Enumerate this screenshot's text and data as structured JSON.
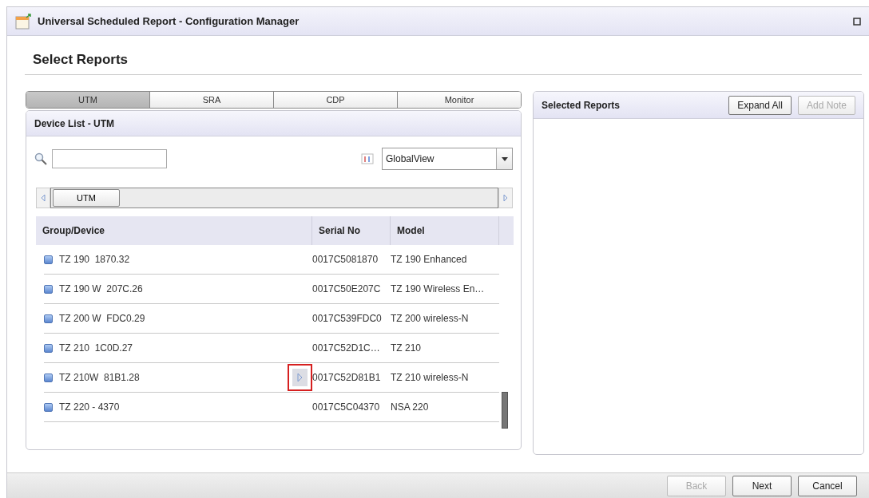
{
  "window": {
    "title": "Universal Scheduled Report - Configuration Manager"
  },
  "page_title": "Select Reports",
  "tabs": [
    {
      "label": "UTM",
      "selected": true
    },
    {
      "label": "SRA",
      "selected": false
    },
    {
      "label": "CDP",
      "selected": false
    },
    {
      "label": "Monitor",
      "selected": false
    }
  ],
  "device_list": {
    "title": "Device List - UTM",
    "view_select": {
      "value": "GlobalView"
    },
    "breadcrumb": [
      "UTM"
    ],
    "columns": [
      "Group/Device",
      "Serial No",
      "Model"
    ],
    "rows": [
      {
        "name": "TZ 190  1870.32",
        "serial": "0017C5081870",
        "model": "TZ 190 Enhanced",
        "hovered": false
      },
      {
        "name": "TZ 190 W  207C.26",
        "serial": "0017C50E207C",
        "model": "TZ 190 Wireless En…",
        "hovered": false
      },
      {
        "name": "TZ 200 W  FDC0.29",
        "serial": "0017C539FDC0",
        "model": "TZ 200 wireless-N",
        "hovered": false
      },
      {
        "name": "TZ 210  1C0D.27",
        "serial": "0017C52D1C…",
        "model": "TZ 210",
        "hovered": false
      },
      {
        "name": "TZ 210W  81B1.28",
        "serial": "0017C52D81B1",
        "model": "TZ 210 wireless-N",
        "hovered": true
      },
      {
        "name": "TZ 220 - 4370",
        "serial": "0017C5C04370",
        "model": "NSA 220",
        "hovered": false
      }
    ]
  },
  "selected_reports": {
    "title": "Selected Reports",
    "buttons": [
      {
        "label": "Expand All",
        "disabled": false
      },
      {
        "label": "Add Note",
        "disabled": true
      }
    ]
  },
  "footer_buttons": [
    {
      "label": "Back",
      "disabled": true
    },
    {
      "label": "Next",
      "disabled": false
    },
    {
      "label": "Cancel",
      "disabled": false
    }
  ]
}
